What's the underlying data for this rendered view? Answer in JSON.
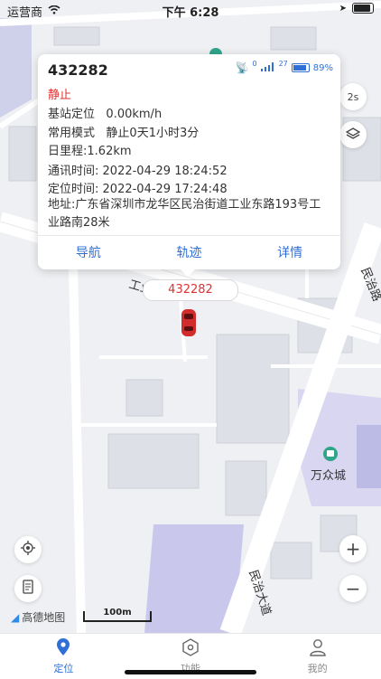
{
  "status_bar": {
    "carrier": "运营商",
    "time": "下午 6:28"
  },
  "vehicle": {
    "id": "432282",
    "state": "静止",
    "signal_count_gps": "0",
    "signal_count_cell": "27",
    "battery": "89%",
    "rows": [
      {
        "label": "基站定位",
        "value": "0.00km/h"
      },
      {
        "label": "常用模式",
        "value": "静止0天1小时3分"
      },
      {
        "label": "日里程:",
        "value": "1.62km"
      },
      {
        "label": "通讯时间:",
        "value": "2022-04-29 18:24:52"
      },
      {
        "label": "定位时间:",
        "value": "2022-04-29 17:24:48"
      }
    ],
    "address": "地址:广东省深圳市龙华区民治街道工业东路193号工业路南28米",
    "actions": [
      "导航",
      "轨迹",
      "详情"
    ],
    "tag": "432282"
  },
  "map": {
    "refresh_label": "2s",
    "poi_name": "万众城",
    "road_labels": [
      "工业",
      "民治路",
      "民治大道"
    ],
    "scale_text": "100m",
    "logo_text": "高德地图"
  },
  "tabbar": {
    "items": [
      {
        "label": "定位",
        "icon": "location-pin-icon",
        "active": true
      },
      {
        "label": "功能",
        "icon": "hexagon-icon",
        "active": false
      },
      {
        "label": "我的",
        "icon": "user-icon",
        "active": false
      }
    ]
  },
  "colors": {
    "accent": "#2f6fd6",
    "state": "#dd3333"
  }
}
